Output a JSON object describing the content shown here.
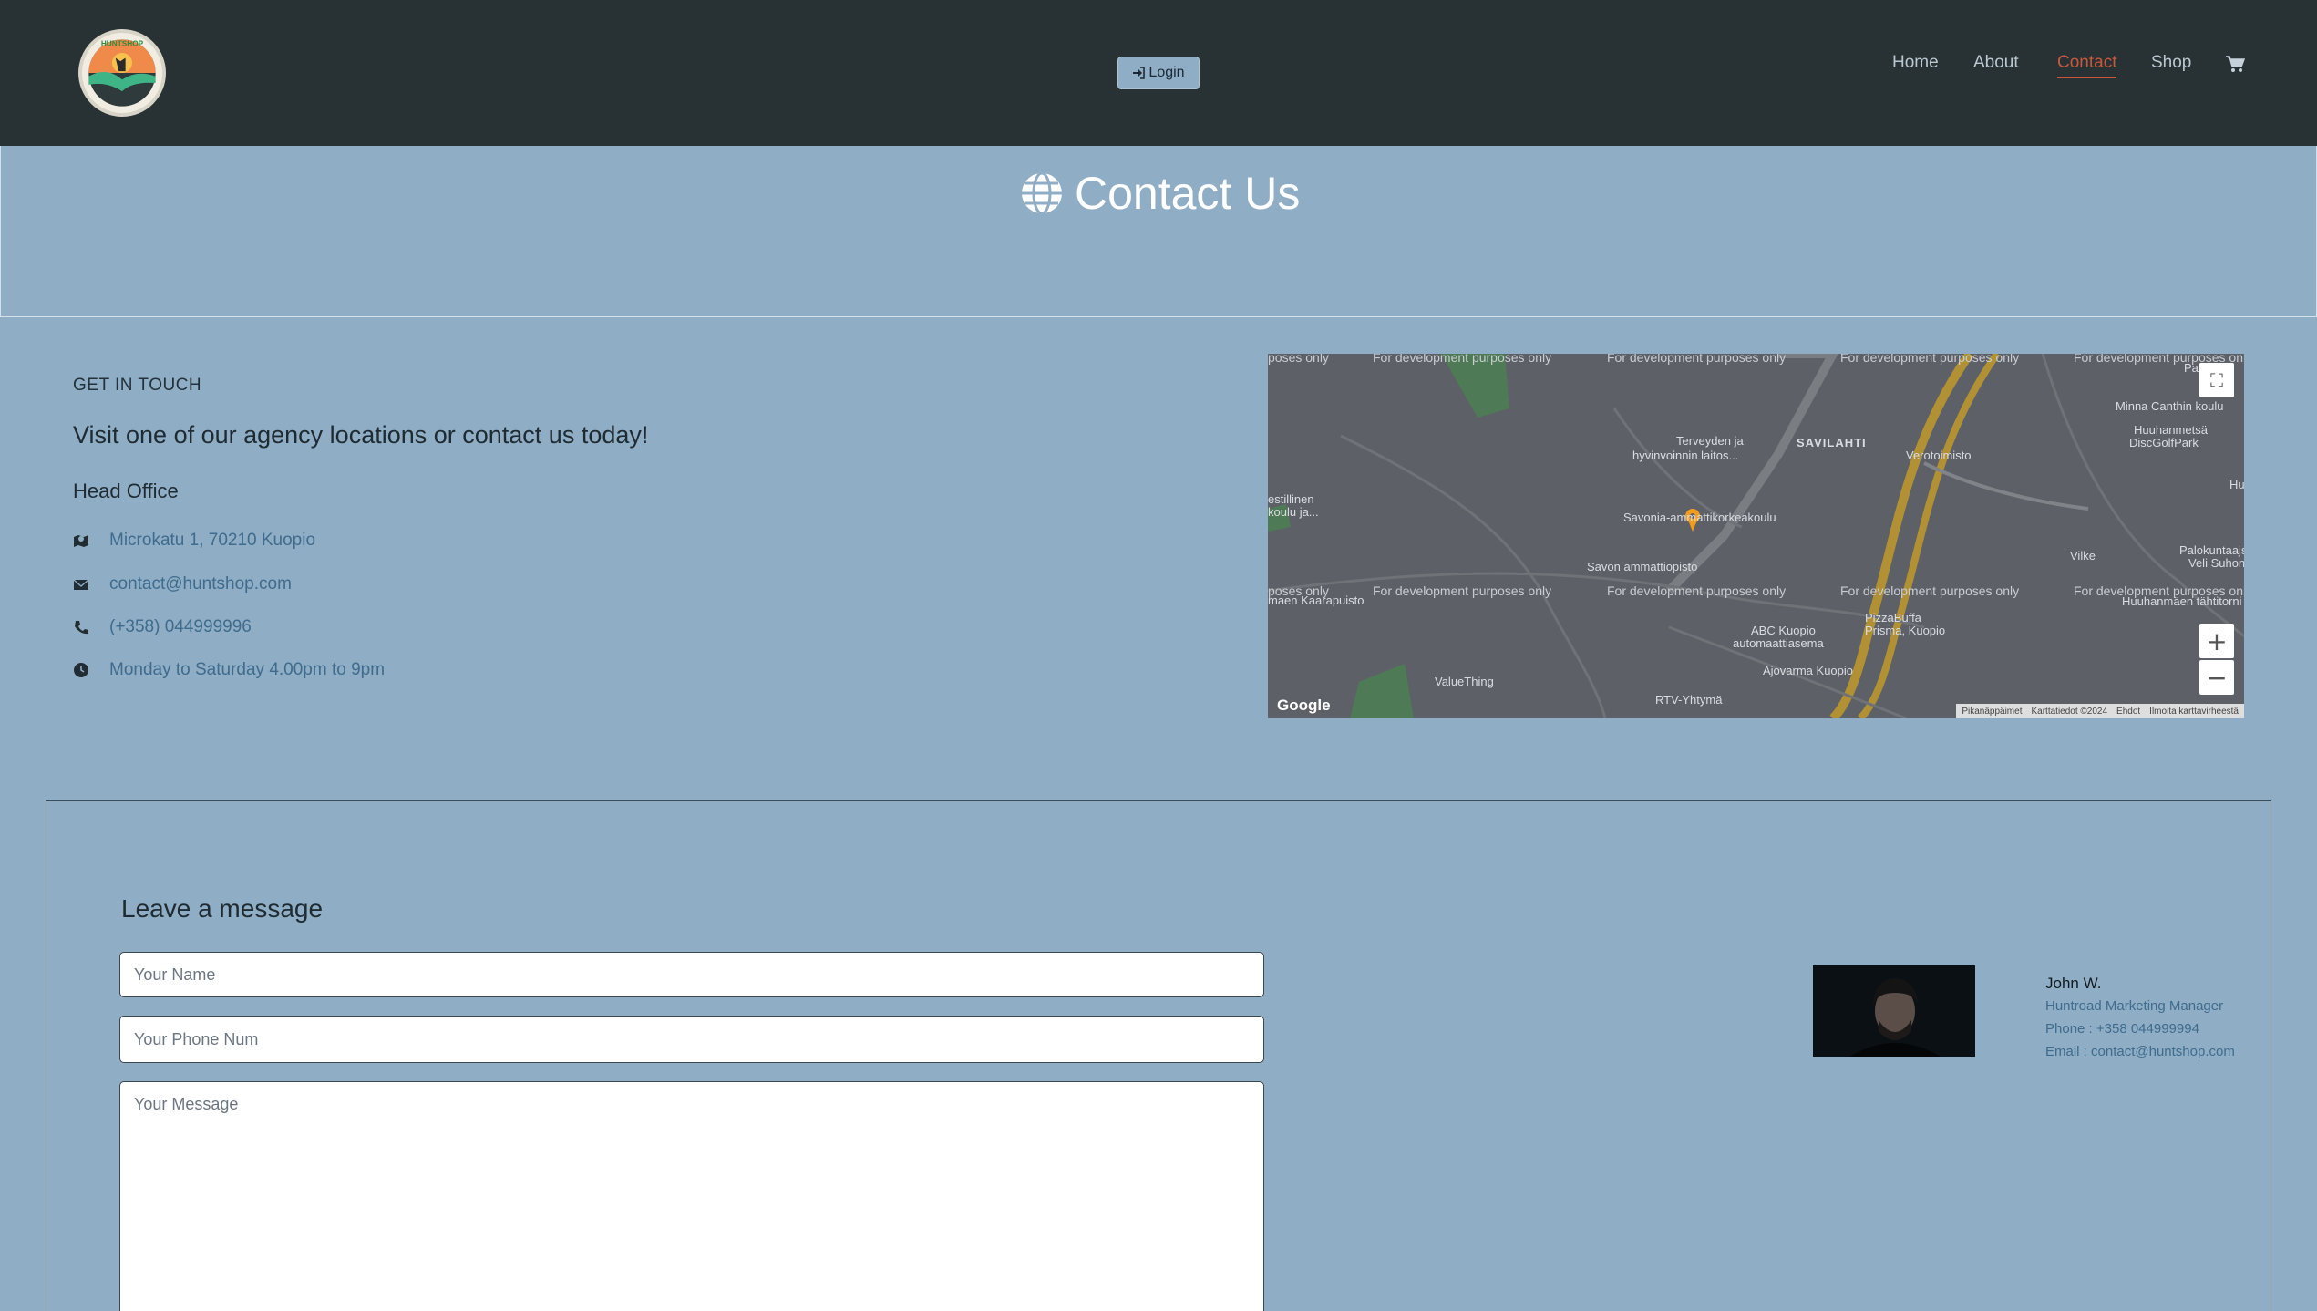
{
  "brand": {
    "logo_text": "HUNTSHOP"
  },
  "header": {
    "login_label": "Login",
    "nav": [
      "Home",
      "About",
      "Contact",
      "Shop"
    ],
    "active": "Contact"
  },
  "hero": {
    "title": "Contact Us",
    "icon": "globe-icon"
  },
  "contact": {
    "eyebrow": "GET IN TOUCH",
    "lead": "Visit one of our agency locations or contact us today!",
    "office": "Head Office",
    "rows": [
      {
        "icon": "map-icon",
        "text": "Microkatu 1, 70210 Kuopio"
      },
      {
        "icon": "envelope-icon",
        "text": "contact@huntshop.com"
      },
      {
        "icon": "phone-icon",
        "text": "(+358) 044999996"
      },
      {
        "icon": "clock-icon",
        "text": "Monday to Saturday 4.00pm to 9pm"
      }
    ]
  },
  "map": {
    "dev_text": "For development purposes only",
    "dev_text_partial": "poses only",
    "labels": {
      "savilahti": "SAVILAHTI",
      "terveyden": "Terveyden ja",
      "hyvinvoinnin": "hyvinvoinnin laitos...",
      "savonia": "Savonia-ammattikorkeakoulu",
      "savon": "Savon ammattiopisto",
      "abc1": "ABC Kuopio",
      "abc2": "automaattiasema",
      "pizza1": "PizzaBuffa",
      "pizza2": "Prisma, Kuopio",
      "ajovarma": "Ajovarma Kuopio",
      "valuething": "ValueThing",
      "rtv": "RTV-Yhtymä",
      "verotoimisto": "Verotoimisto",
      "minna": "Minna Canthin koulu",
      "huuhanmetsa1": "Huuhanmetsä",
      "huuhanmetsa2": "DiscGolfPark",
      "vilke": "Vilke",
      "palokunta1": "Palokuntaajsorav",
      "palokunta2": "Veli Suhonen",
      "tahtitorni": "Huuhanmäen tähtitorni",
      "koulu1": "estillinen",
      "koulu2": "koulu ja...",
      "kaarapuisto": "maen Kaarapuisto",
      "palvelu": "Palveluj",
      "huu": "Hu"
    },
    "brand": "Google",
    "footer": [
      "Pikanäppäimet",
      "Karttatiedot ©2024",
      "Ehdot",
      "Ilmoita karttavirheestä"
    ],
    "zoom_in": "+",
    "zoom_out": "−"
  },
  "form": {
    "title": "Leave a message",
    "name_placeholder": "Your Name",
    "phone_placeholder": "Your Phone Num",
    "message_placeholder": "Your Message"
  },
  "agent": {
    "name": "John W.",
    "role": "Huntroad Marketing Manager",
    "phone": "Phone : +358 044999994",
    "email": "Email : contact@huntshop.com"
  },
  "colors": {
    "navbar": "#283235",
    "page": "#8fadc4",
    "accent": "#c8583c",
    "link": "#3f6c8e"
  }
}
